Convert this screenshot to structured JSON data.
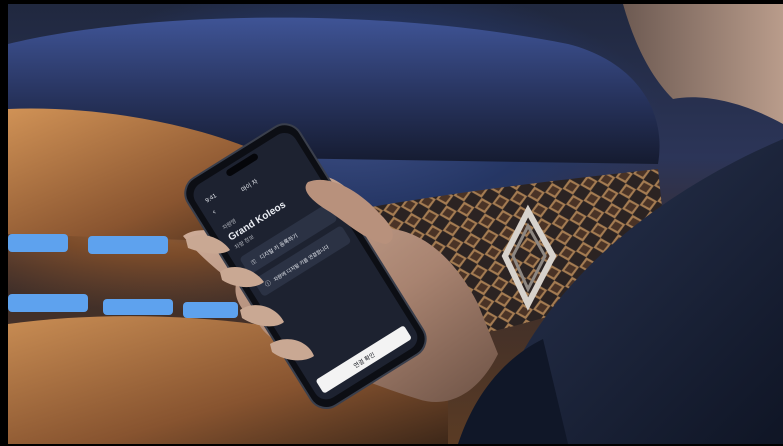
{
  "phone": {
    "status_time": "9:41",
    "header_title": "마이 차",
    "vehicle_label": "차량명",
    "vehicle_name": "Grand Koleos",
    "vehicle_sub": "차량 정보",
    "card1_text": "디지털 키 등록하기",
    "card2_text": "차량에 디지털 키를 연결합니다",
    "cta_label": "연결 확인"
  },
  "logo": {
    "brand": "Renault"
  },
  "colors": {
    "phone_screen": "#1d2230",
    "card": "#2b3244",
    "accent": "#6ea0ff",
    "cta": "#f3f3f3"
  }
}
